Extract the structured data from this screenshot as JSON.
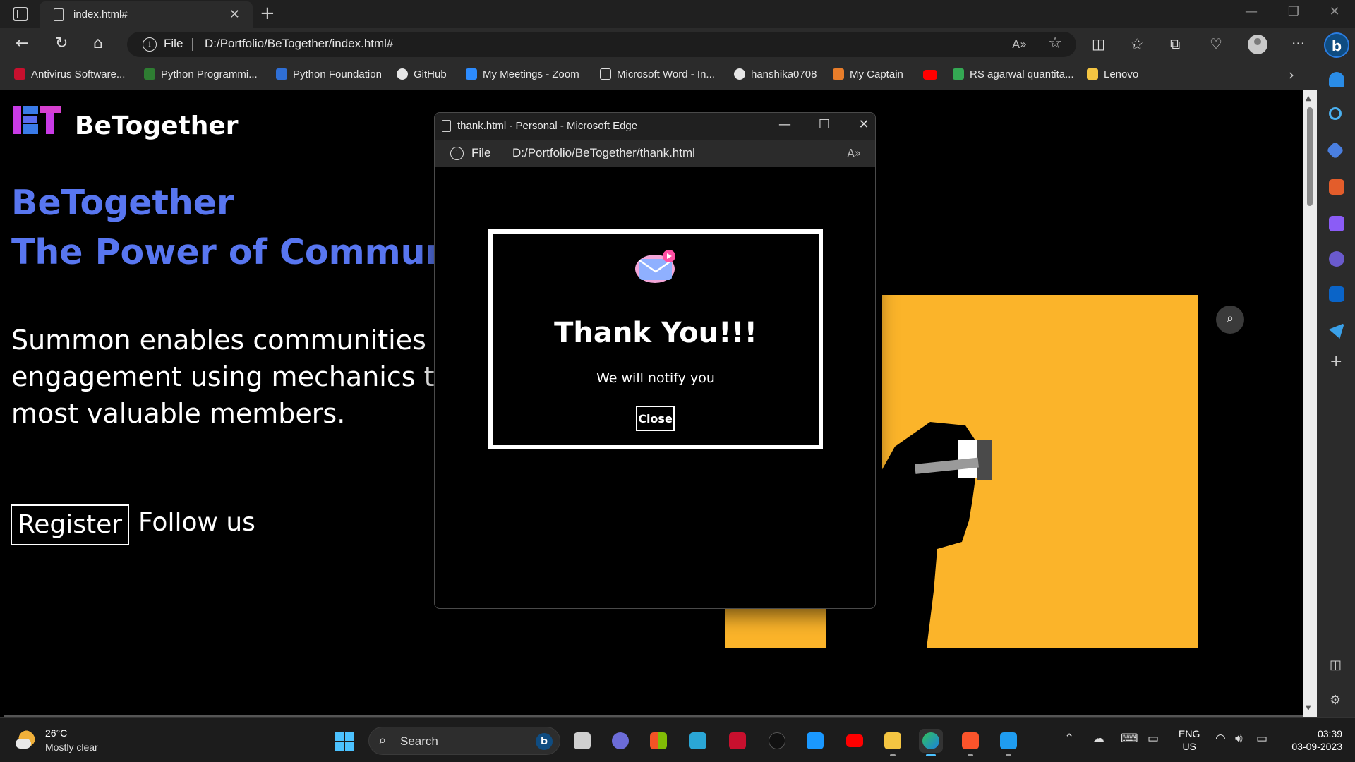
{
  "browser": {
    "tab_title": "index.html#",
    "address_scheme": "File",
    "address_url": "D:/Portfolio/BeTogether/index.html#",
    "favorites": [
      {
        "label": "Antivirus Software...",
        "color": "#c8102e"
      },
      {
        "label": "Python Programmi...",
        "color": "#2e7d32"
      },
      {
        "label": "Python Foundation",
        "color": "#2f6fd6"
      },
      {
        "label": "GitHub",
        "color": "#e6e6e6"
      },
      {
        "label": "My Meetings - Zoom",
        "color": "#2d8cff"
      },
      {
        "label": "Microsoft Word - In...",
        "color": "#dddddd"
      },
      {
        "label": "hanshika0708",
        "color": "#e6e6e6"
      },
      {
        "label": "My Captain",
        "color": "#e87d2a"
      },
      {
        "label": "",
        "color": "#ff0000"
      },
      {
        "label": "RS agarwal quantita...",
        "color": "#34a853"
      },
      {
        "label": "Lenovo",
        "color": "#f4c542"
      }
    ]
  },
  "page": {
    "brand": "BeTogether",
    "hero_title_line1": "BeTogether",
    "hero_title_line2": "The Power of Community",
    "hero_text": "Summon enables communities to grow participation and engagement using mechanics that help identify, reward their most valuable members.",
    "register_label": "Register",
    "follow_label": "Follow us",
    "accent_color": "#5876f0",
    "art_color": "#fbb42a"
  },
  "popup": {
    "window_title": "thank.html - Personal - Microsoft Edge",
    "address_scheme": "File",
    "address_url": "D:/Portfolio/BeTogether/thank.html",
    "heading": "Thank You!!!",
    "message": "We will notify you",
    "close_label": "Close"
  },
  "taskbar": {
    "temperature": "26°C",
    "condition": "Mostly clear",
    "search_label": "Search",
    "language": "ENG",
    "region": "US",
    "time": "03:39",
    "date": "03-09-2023"
  }
}
